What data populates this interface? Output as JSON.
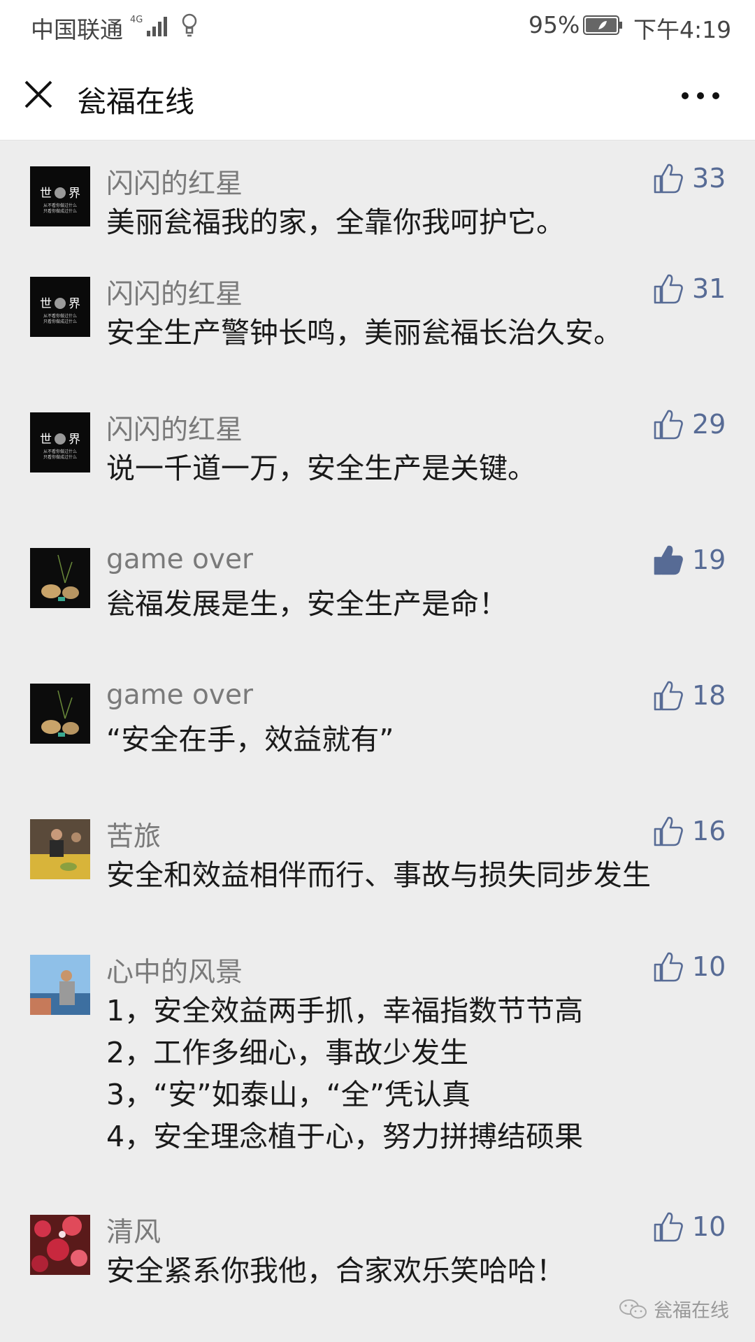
{
  "status_bar": {
    "carrier": "中国联通",
    "network": "4G",
    "battery": "95%",
    "time": "下午4:19"
  },
  "header": {
    "title": "瓮福在线",
    "close_icon": "close-icon",
    "more_icon": "more-dots-icon"
  },
  "colors": {
    "accent": "#576b95",
    "background": "#ededed"
  },
  "comments": [
    {
      "nickname": "闪闪的红星",
      "likes": "33",
      "liked": false,
      "avatar": "world",
      "lines": [
        "美丽瓮福我的家，全靠你我呵护它。"
      ]
    },
    {
      "nickname": "闪闪的红星",
      "likes": "31",
      "liked": false,
      "avatar": "world",
      "lines": [
        "安全生产警钟长鸣，美丽瓮福长治久安。"
      ]
    },
    {
      "nickname": "闪闪的红星",
      "likes": "29",
      "liked": false,
      "avatar": "world",
      "lines": [
        "说一千道一万，安全生产是关键。"
      ]
    },
    {
      "nickname": "game over",
      "likes": "19",
      "liked": true,
      "avatar": "teapot",
      "lines": [
        "瓮福发展是生，安全生产是命！"
      ]
    },
    {
      "nickname": "game over",
      "likes": "18",
      "liked": false,
      "avatar": "teapot",
      "lines": [
        "“安全在手，效益就有”"
      ]
    },
    {
      "nickname": "苦旅",
      "likes": "16",
      "liked": false,
      "avatar": "dinner",
      "lines": [
        "安全和效益相伴而行、事故与损失同步发生"
      ]
    },
    {
      "nickname": "心中的风景",
      "likes": "10",
      "liked": false,
      "avatar": "seaside",
      "lines": [
        "1，安全效益两手抓，幸福指数节节高",
        "2，工作多细心，事故少发生",
        "3，“安”如泰山，“全”凭认真",
        "4，安全理念植于心，努力拼搏结硕果"
      ]
    },
    {
      "nickname": "清风",
      "likes": "10",
      "liked": false,
      "avatar": "flowers",
      "lines": [
        "安全紧系你我他，合家欢乐笑哈哈！"
      ]
    }
  ],
  "avatar_text": {
    "world_title_left": "世",
    "world_title_right": "界",
    "world_line1": "从不看你做过什么",
    "world_line2": "只看你做成过什么"
  },
  "watermark": {
    "text": "瓮福在线",
    "icon": "wechat-icon"
  }
}
